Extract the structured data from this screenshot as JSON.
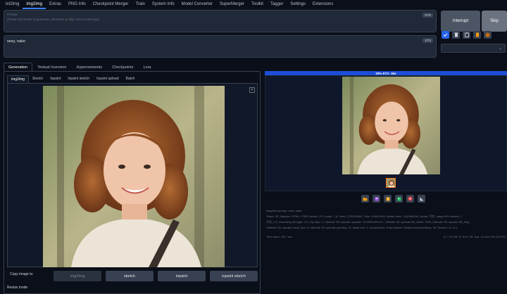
{
  "top_tabs": [
    "txt2img",
    "img2img",
    "Extras",
    "PNG Info",
    "Checkpoint Merger",
    "Train",
    "System Info",
    "Model Converter",
    "SuperMerger",
    "Toolkit",
    "Tagger",
    "Settings",
    "Extensions"
  ],
  "prompt": {
    "placeholder_title": "Prompt",
    "placeholder_hint": "(Press Ctrl+Enter to generate, Alt+Enter to skip, Esc to interrupt)",
    "counter": "0/75"
  },
  "negative_prompt": {
    "value": "sexy, nake",
    "counter": "1/75"
  },
  "buttons": {
    "interrupt": "Interrupt",
    "skip": "Skip"
  },
  "tool_icons": [
    "arrow-icon",
    "trash-icon",
    "clipboard-icon",
    "save-style-icon",
    "palette-icon"
  ],
  "sub_tabs": [
    "Generation",
    "Textual Inversion",
    "Hypernetworks",
    "Checkpoints",
    "Lora"
  ],
  "image_tabs": [
    "img2img",
    "Sketch",
    "Inpaint",
    "Inpaint sketch",
    "Inpaint upload",
    "Batch"
  ],
  "copy_label": "Copy image to:",
  "copy_buttons": [
    "img2img",
    "sketch",
    "inpaint",
    "inpaint sketch"
  ],
  "resize_label": "Resize mode",
  "progress": {
    "text": "30% ETA: 36s",
    "fraction": 0.3
  },
  "info_lines": [
    "Negative prompt: sexy, nake",
    "Steps: 20, Sampler: DPM++ SDE Karras, CFG scale: 7.5, Seed: 2734225567, Size: 1040x1560, Model hash: 7c829b8155, Model: 写实, mage.993 models, 1",
    "写实_1.5, Denoising strength: 0.5, Clip skip: 2, Ultimate SD upscale upscaler: R-ESRGAN 4x+, Ultimate SD upscale tile_width: 1536, Ultimate SD upscale tile_heig",
    "Ultimate SD upscale mask_blur: 8, Ultimate SD upscale padding: 32, Mask blur: 4, Inpaint area: Only masked, Masked area padding: 32, Version: v1.10.1"
  ],
  "footer_left": "Time taken: 36.7 sec.",
  "footer_right": "A: 7.24 GB, R: 9.61 GB, Sys: 10.4/24 GB (43.5%)"
}
